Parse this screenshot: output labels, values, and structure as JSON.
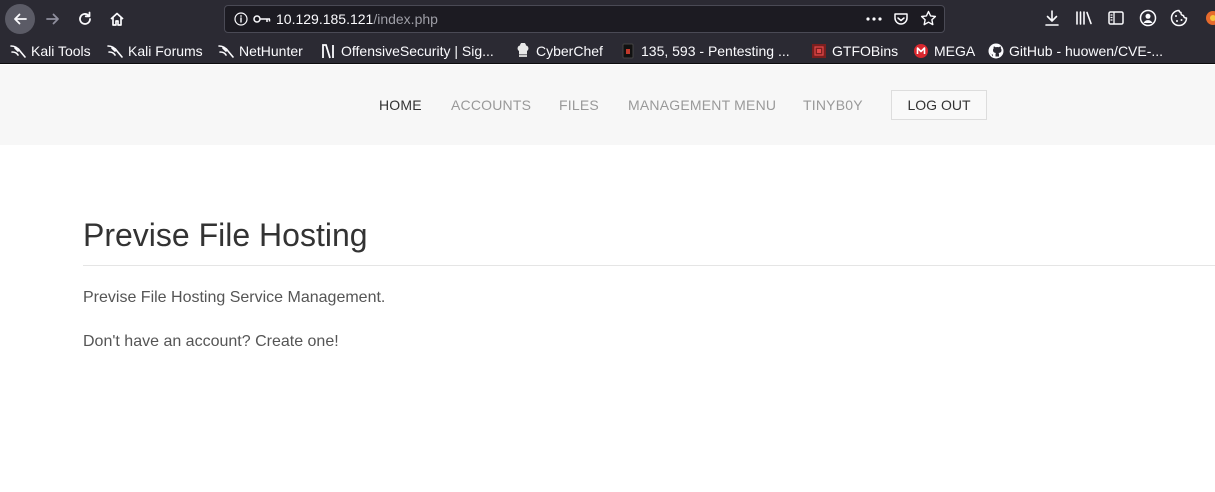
{
  "browser": {
    "url_host": "10.129.185.121",
    "url_path": "/index.php",
    "icons": {
      "back": "back-arrow-icon",
      "forward": "forward-arrow-icon",
      "reload": "reload-icon",
      "home": "home-icon",
      "site_info": "info-icon",
      "key": "key-icon",
      "page_actions": "more-dots-icon",
      "pocket": "pocket-icon",
      "bookmark_star": "star-icon",
      "downloads": "download-icon",
      "library": "library-icon",
      "sidebar": "sidebar-icon",
      "account": "account-icon",
      "addon": "cookie-icon",
      "extension": "extension-icon"
    },
    "colors": {
      "chrome": "#2b2a33",
      "urlbar": "#1c1b22",
      "text": "#fbfbfe"
    }
  },
  "bookmarks": [
    {
      "label": "Kali Tools",
      "icon": "kali-dragon-icon"
    },
    {
      "label": "Kali Forums",
      "icon": "kali-dragon-icon"
    },
    {
      "label": "NetHunter",
      "icon": "kali-dragon-icon"
    },
    {
      "label": "OffensiveSecurity | Sig...",
      "icon": "offsec-icon"
    },
    {
      "label": "CyberChef",
      "icon": "chef-hat-icon"
    },
    {
      "label": "135, 593 - Pentesting ...",
      "icon": "hacktricks-icon"
    },
    {
      "label": "GTFOBins",
      "icon": "gtfobins-icon"
    },
    {
      "label": "MEGA",
      "icon": "mega-icon"
    },
    {
      "label": "GitHub - huowen/CVE-...",
      "icon": "github-icon"
    }
  ],
  "site": {
    "nav": {
      "home": "HOME",
      "accounts": "ACCOUNTS",
      "files": "FILES",
      "management": "MANAGEMENT MENU",
      "user": "TINYB0Y",
      "logout": "LOG OUT"
    },
    "title": "Previse File Hosting",
    "paragraph1": "Previse File Hosting Service Management.",
    "paragraph2": "Don't have an account? Create one!"
  }
}
